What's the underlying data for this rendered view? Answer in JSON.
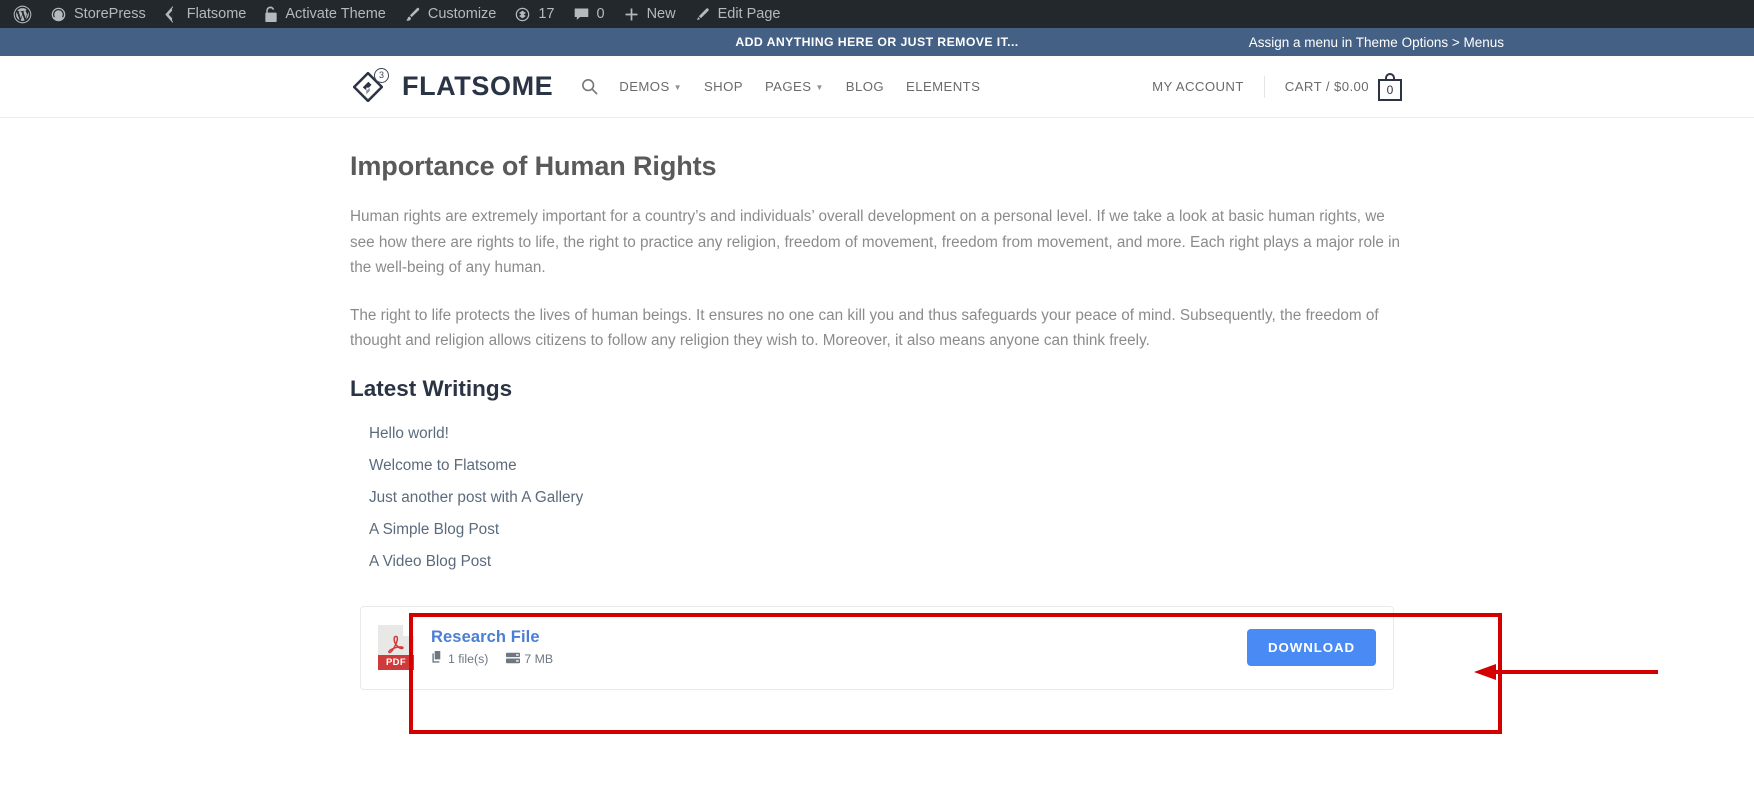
{
  "admin_bar": {
    "items": [
      {
        "label": "",
        "icon": "wordpress-logo-icon",
        "name": "wp-logo"
      },
      {
        "label": "StorePress",
        "icon": "dashboard-icon",
        "name": "site-name"
      },
      {
        "label": "Flatsome",
        "icon": "flatsome-icon",
        "name": "flatsome-menu"
      },
      {
        "label": "Activate Theme",
        "icon": "unlock-icon",
        "name": "activate-theme"
      },
      {
        "label": "Customize",
        "icon": "brush-icon",
        "name": "customize"
      },
      {
        "label": "17",
        "icon": "updates-icon",
        "name": "updates"
      },
      {
        "label": "0",
        "icon": "comment-bubble-icon",
        "name": "comments"
      },
      {
        "label": "New",
        "icon": "plus-icon",
        "name": "new-content"
      },
      {
        "label": "Edit Page",
        "icon": "pencil-icon",
        "name": "edit-page"
      }
    ]
  },
  "notice_bar": {
    "message": "ADD ANYTHING HERE OR JUST REMOVE IT...",
    "right_link": "Assign a menu in Theme Options > Menus",
    "background": "#446084"
  },
  "header": {
    "logo_text": "FLATSOME",
    "logo_badge": "3",
    "nav": [
      {
        "label": "DEMOS",
        "has_caret": true
      },
      {
        "label": "SHOP",
        "has_caret": false
      },
      {
        "label": "PAGES",
        "has_caret": true
      },
      {
        "label": "BLOG",
        "has_caret": false
      },
      {
        "label": "ELEMENTS",
        "has_caret": false
      }
    ],
    "search_icon": "search-icon",
    "account_label": "MY ACCOUNT",
    "cart_label": "CART / $0.00",
    "cart_count": "0"
  },
  "page": {
    "title": "Importance of Human Rights",
    "paragraphs": [
      "Human rights are extremely important for a country’s and individuals’ overall development on a personal level. If we take a look at basic human rights, we see how there are rights to life, the right to practice any religion, freedom of movement, freedom from movement, and more. Each right plays a major role in the well-being of any human.",
      "The right to life protects the lives of human beings. It ensures no one can kill you and thus safeguards your peace of mind. Subsequently, the freedom of thought and religion allows citizens to follow any religion they wish to. Moreover, it also means anyone can think freely."
    ],
    "section_title": "Latest Writings",
    "writings": [
      "Hello world!",
      "Welcome to Flatsome",
      "Just another post with A Gallery",
      "A Simple Blog Post",
      "A Video Blog Post"
    ]
  },
  "download_card": {
    "file_type": "PDF",
    "title": "Research File",
    "file_count": "1 file(s)",
    "file_size": "7 MB",
    "button_label": "DOWNLOAD",
    "button_color": "#4a8af4",
    "title_color": "#4a7fd4"
  },
  "annotation": {
    "highlight_color": "#d40000",
    "target": "download-card"
  }
}
